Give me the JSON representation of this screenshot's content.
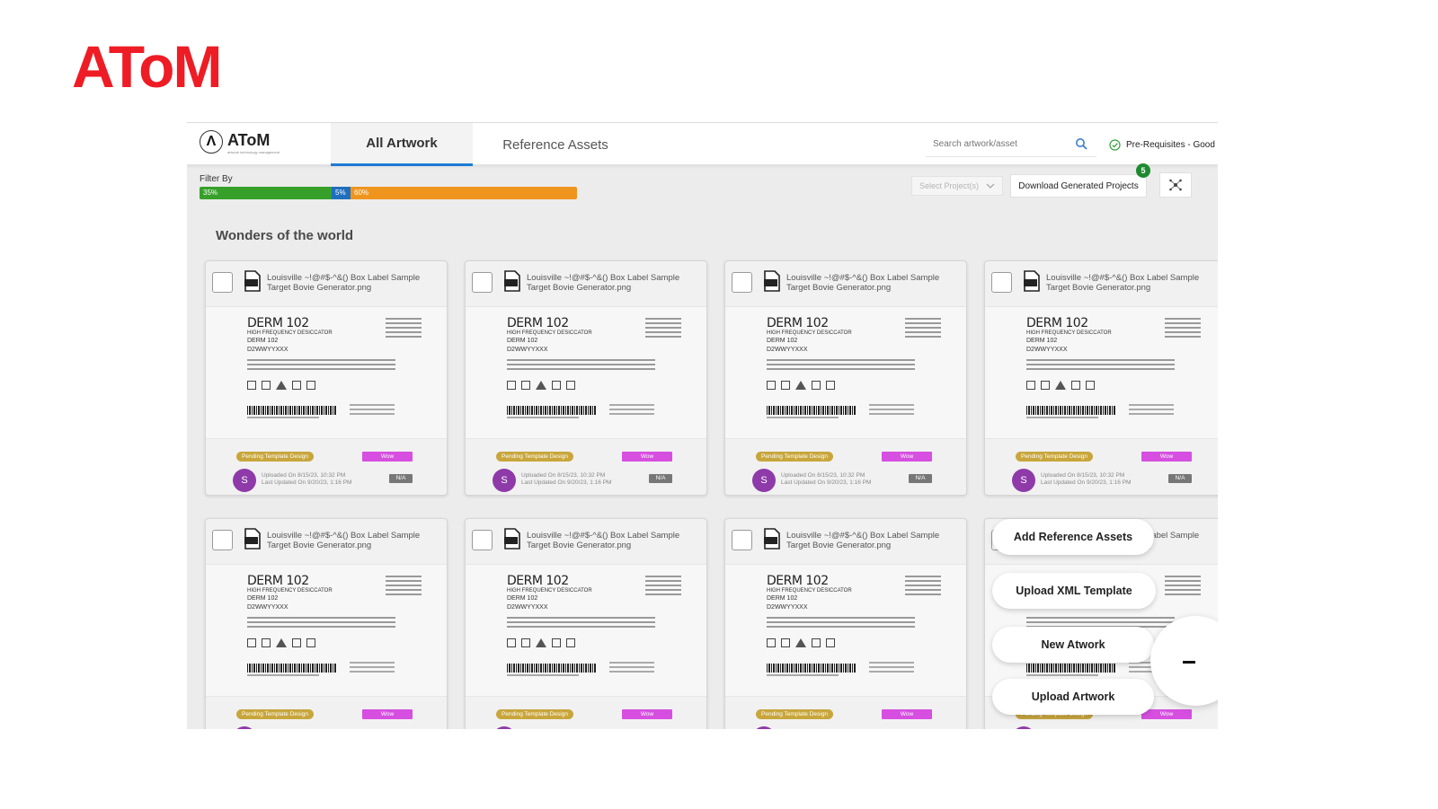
{
  "slide": {
    "title": "AToM"
  },
  "app": {
    "brand": {
      "symbol": "Λ",
      "name": "AToM",
      "tagline": "artwork technology management"
    },
    "tabs": [
      {
        "label": "All Artwork",
        "active": true
      },
      {
        "label": "Reference Assets",
        "active": false
      }
    ],
    "search": {
      "placeholder": "Search artwork/asset"
    },
    "prerequisites": {
      "label": "Pre-Requisites - Good"
    },
    "filter": {
      "label": "Filter By",
      "segments": [
        {
          "label": "35%",
          "value": 35,
          "color": "#36a02a"
        },
        {
          "label": "5%",
          "value": 5,
          "color": "#1f6fbe"
        },
        {
          "label": "60%",
          "value": 60,
          "color": "#ef951e"
        }
      ]
    },
    "project_select": {
      "placeholder": "Select Project(s)"
    },
    "download": {
      "label": "Download Generated Projects",
      "badge": "5"
    },
    "section_title": "Wonders of the world",
    "card_template": {
      "title_line1": "Louisville ~!@#$-^&() Box Label Sample",
      "title_line2": "Target Bovie Generator.png",
      "label_title": "DERM 102",
      "label_sub": "HIGH FREQUENCY DESICCATOR",
      "label_ref": "DERM 102",
      "label_sn": "D2WWYYXXX",
      "status": "Pending Template Design",
      "tag": "Wow",
      "avatar": "S",
      "uploaded": "Uploaded On 8/15/23, 10:32 PM",
      "updated": "Last Updated On 9/20/23, 1:16 PM",
      "na": "N/A"
    },
    "fab_menu": [
      {
        "label": "Add Reference Assets"
      },
      {
        "label": "Upload XML Template"
      },
      {
        "label": "New Atwork"
      },
      {
        "label": "Upload Artwork"
      }
    ]
  }
}
